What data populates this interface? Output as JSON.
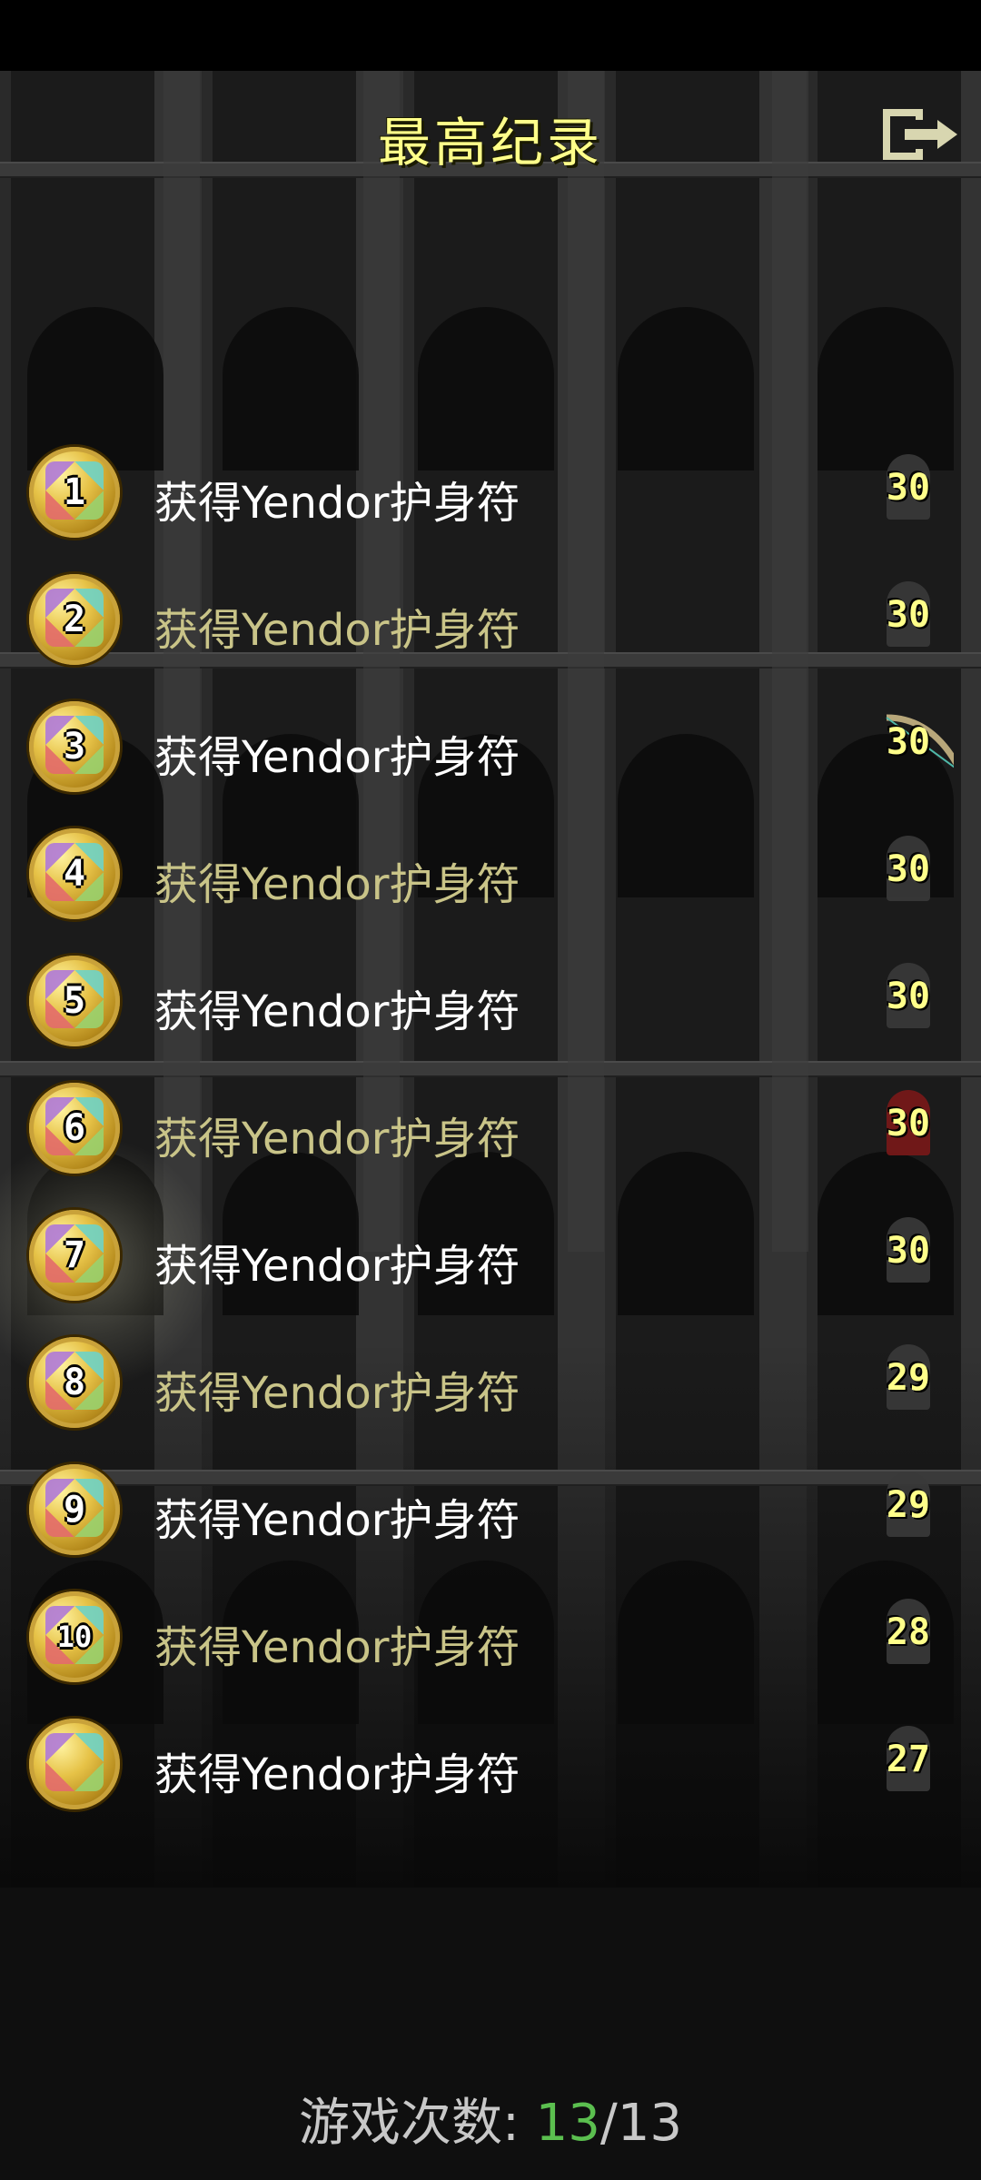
{
  "title": "最高纪录",
  "exit_icon": "exit-icon",
  "records": [
    {
      "rank": "1",
      "text": "获得Yendor护身符",
      "depth": "30",
      "style": "bright",
      "icon": "helmet-icon"
    },
    {
      "rank": "2",
      "text": "获得Yendor护身符",
      "depth": "30",
      "style": "dim",
      "icon": "helmet-icon"
    },
    {
      "rank": "3",
      "text": "获得Yendor护身符",
      "depth": "30",
      "style": "bright",
      "icon": "bow-icon"
    },
    {
      "rank": "4",
      "text": "获得Yendor护身符",
      "depth": "30",
      "style": "dim",
      "icon": "helmet-icon"
    },
    {
      "rank": "5",
      "text": "获得Yendor护身符",
      "depth": "30",
      "style": "bright",
      "icon": "helmet-icon"
    },
    {
      "rank": "6",
      "text": "获得Yendor护身符",
      "depth": "30",
      "style": "dim",
      "icon": "red-hood-icon"
    },
    {
      "rank": "7",
      "text": "获得Yendor护身符",
      "depth": "30",
      "style": "bright",
      "icon": "helmet-icon"
    },
    {
      "rank": "8",
      "text": "获得Yendor护身符",
      "depth": "29",
      "style": "dim",
      "icon": "helmet-icon"
    },
    {
      "rank": "9",
      "text": "获得Yendor护身符",
      "depth": "29",
      "style": "bright",
      "icon": "helmet-icon"
    },
    {
      "rank": "10",
      "text": "获得Yendor护身符",
      "depth": "28",
      "style": "dim",
      "icon": "helmet-icon"
    },
    {
      "rank": "",
      "text": "获得Yendor护身符",
      "depth": "27",
      "style": "bright",
      "icon": "helmet-icon"
    }
  ],
  "footer": {
    "label": "游戏次数: ",
    "played": "13",
    "separator": "/",
    "total": "13"
  },
  "colors": {
    "title": "#ffff8a",
    "bright_text": "#ffffff",
    "dim_text": "#c9c488",
    "played": "#5bbf4f"
  }
}
